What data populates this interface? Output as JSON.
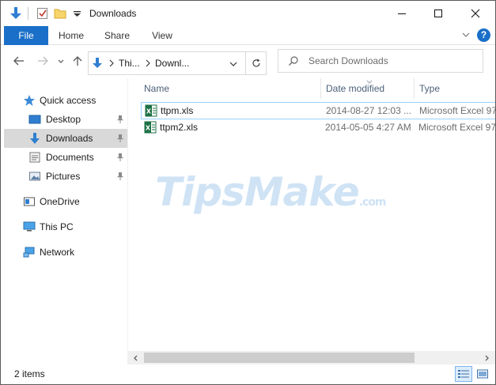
{
  "window": {
    "title": "Downloads"
  },
  "ribbon": {
    "tabs": [
      "File",
      "Home",
      "Share",
      "View"
    ],
    "help_label": "?"
  },
  "address_bar": {
    "crumbs": [
      "Thi...",
      "Downl..."
    ],
    "search_placeholder": "Search Downloads"
  },
  "nav_pane": {
    "quick_access": "Quick access",
    "pinned": [
      {
        "label": "Desktop",
        "icon": "desktop-icon",
        "pinned": true
      },
      {
        "label": "Downloads",
        "icon": "download-arrow-icon",
        "pinned": true,
        "selected": true
      },
      {
        "label": "Documents",
        "icon": "documents-icon",
        "pinned": true
      },
      {
        "label": "Pictures",
        "icon": "pictures-icon",
        "pinned": true
      }
    ],
    "onedrive": "OneDrive",
    "this_pc": "This PC",
    "network": "Network"
  },
  "columns": {
    "name": "Name",
    "date_modified": "Date modified",
    "type": "Type"
  },
  "files": [
    {
      "name": "ttpm.xls",
      "date": "2014-08-27 12:03 ...",
      "type": "Microsoft Excel 97"
    },
    {
      "name": "ttpm2.xls",
      "date": "2014-05-05 4:27 AM",
      "type": "Microsoft Excel 97"
    }
  ],
  "watermark": {
    "brand": "TipsMake",
    "suffix": ".com"
  },
  "status": {
    "item_count": "2 items"
  },
  "colors": {
    "accent": "#1a6fc8",
    "selection": "#d9d9d9",
    "focus_border": "#99d1ff",
    "excel_green": "#1e7145"
  }
}
